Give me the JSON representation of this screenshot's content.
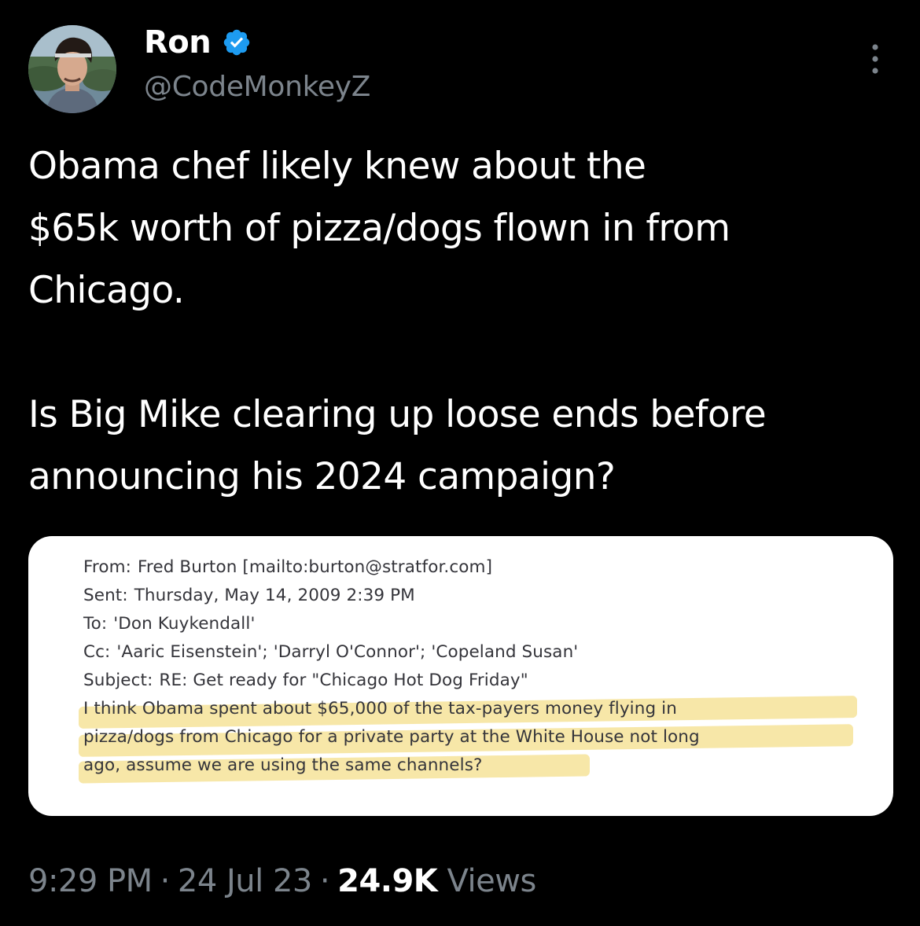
{
  "author": {
    "display_name": "Ron",
    "handle": "@CodeMonkeyZ",
    "verified": true,
    "avatar_icon": "profile-photo-avatar"
  },
  "tweet": {
    "paragraph1": [
      "Obama chef likely knew about the",
      "$65k worth of pizza/dogs flown in from",
      "Chicago."
    ],
    "paragraph2": [
      "Is Big Mike clearing up loose ends before",
      "announcing his 2024 campaign?"
    ]
  },
  "email": {
    "from_label": "From:",
    "from_value": "Fred Burton [mailto:burton@stratfor.com]",
    "sent_label": "Sent:",
    "sent_value": "Thursday, May 14, 2009 2:39 PM",
    "to_label": "To:",
    "to_value": "'Don Kuykendall'",
    "cc_label": "Cc:",
    "cc_value": "'Aaric Eisenstein'; 'Darryl O'Connor'; 'Copeland Susan'",
    "subject_label": "Subject:",
    "subject_value": "RE: Get ready for \"Chicago Hot Dog Friday\"",
    "body_lines": [
      "I think Obama spent about $65,000 of the tax-payers money flying in",
      "pizza/dogs from Chicago for a private party at the White House not long",
      "ago, assume we are using the same channels?"
    ],
    "highlight_color": "#f7e6a3"
  },
  "meta": {
    "time": "9:29 PM",
    "date": "24 Jul 23",
    "separator": "·",
    "views_count": "24.9K",
    "views_label": "Views"
  },
  "colors": {
    "background": "#000000",
    "text_primary": "#ffffff",
    "text_secondary": "#7c848c",
    "verified_badge": "#1d9bf0"
  }
}
